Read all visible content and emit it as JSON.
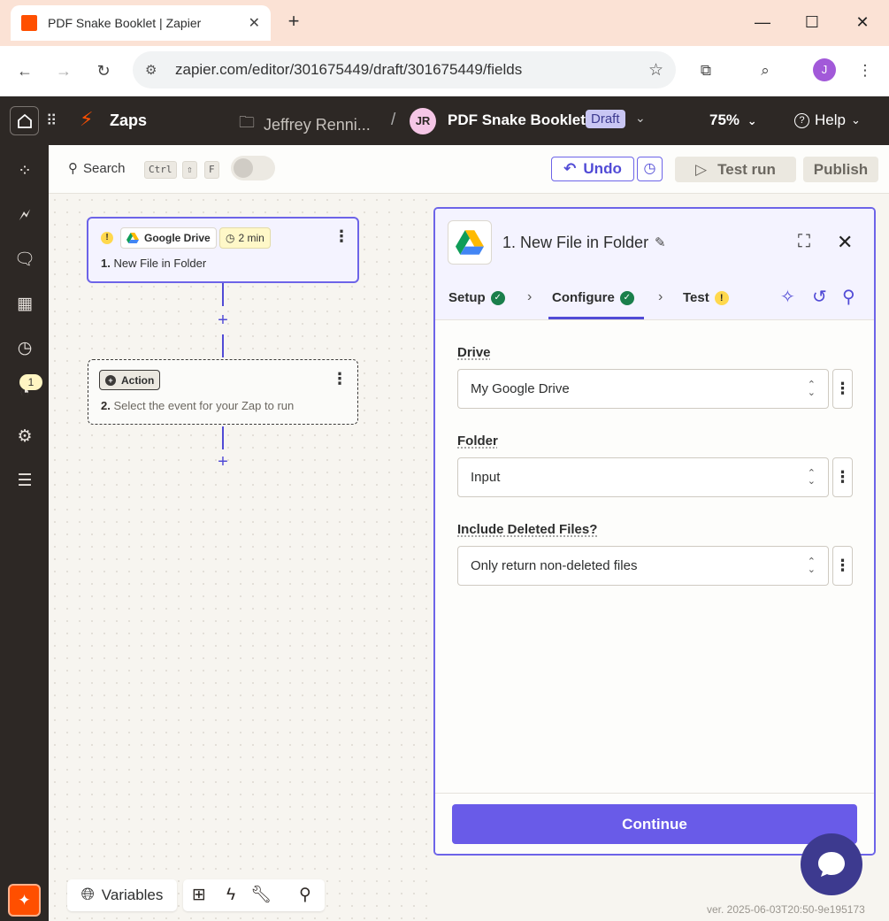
{
  "browser": {
    "tab_title": "PDF Snake Booklet | Zapier",
    "new_tab": "+",
    "url": "zapier.com/editor/301675449/draft/301675449/fields",
    "profile_initial": "J"
  },
  "topbar": {
    "zaps_label": "Zaps",
    "folder_name": "Jeffrey Renni...",
    "separator": "/",
    "owner_initials": "JR",
    "zap_name": "PDF Snake Booklet",
    "status_badge": "Draft",
    "zoom": "75%",
    "help_label": "Help"
  },
  "sidebar": {
    "notification_count": "1"
  },
  "toolbar": {
    "search_label": "Search",
    "shortcut_keys": [
      "Ctrl",
      "⇧",
      "F"
    ],
    "undo_label": "Undo",
    "test_run_label": "Test run",
    "publish_label": "Publish"
  },
  "canvas": {
    "step1": {
      "warning": "!",
      "app_name": "Google Drive",
      "duration": "2 min",
      "number": "1.",
      "title": "New File in Folder"
    },
    "step2": {
      "type_label": "Action",
      "number": "2.",
      "title": "Select the event for your Zap to run"
    }
  },
  "panel": {
    "title": "1. New File in Folder",
    "tabs": [
      {
        "label": "Setup",
        "status": "complete"
      },
      {
        "label": "Configure",
        "status": "complete"
      },
      {
        "label": "Test",
        "status": "warning"
      }
    ],
    "fields": [
      {
        "label": "Drive",
        "value": "My Google Drive"
      },
      {
        "label": "Folder",
        "value": "Input"
      },
      {
        "label": "Include Deleted Files?",
        "value": "Only return non-deleted files"
      }
    ],
    "continue_label": "Continue"
  },
  "bottom": {
    "variables_label": "Variables",
    "version": "ver. 2025-06-03T20:50-9e195173"
  },
  "colors": {
    "brand_orange": "#ff4f00",
    "accent_purple": "#695be8",
    "success_green": "#1a7f4b",
    "warning_yellow": "#ffd84d",
    "dark_bar": "#2d2825"
  }
}
